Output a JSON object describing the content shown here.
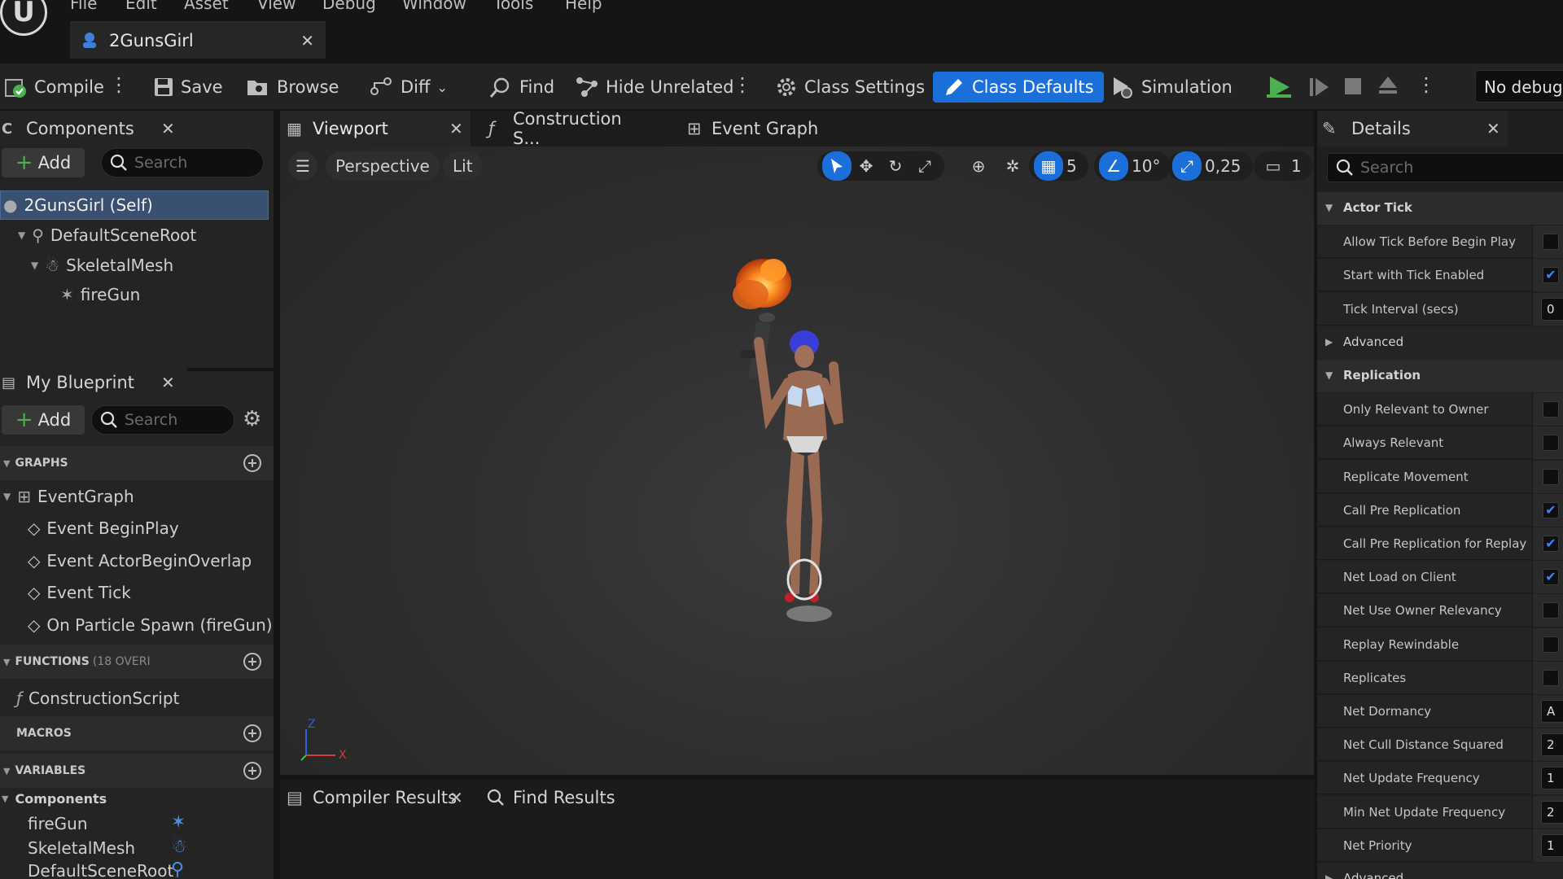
{
  "menu": [
    "File",
    "Edit",
    "Asset",
    "View",
    "Debug",
    "Window",
    "Tools",
    "Help"
  ],
  "document_tab": {
    "title": "2GunsGirl"
  },
  "toolbar": {
    "compile": "Compile",
    "save": "Save",
    "browse": "Browse",
    "diff": "Diff",
    "find": "Find",
    "hide_unrelated": "Hide Unrelated",
    "class_settings": "Class Settings",
    "class_defaults": "Class Defaults",
    "simulation": "Simulation",
    "debug_filter": "No debug o"
  },
  "components_panel": {
    "title": "Components",
    "add": "Add",
    "search_placeholder": "Search",
    "tree": [
      {
        "label": "2GunsGirl (Self)"
      },
      {
        "label": "DefaultSceneRoot"
      },
      {
        "label": "SkeletalMesh"
      },
      {
        "label": "fireGun"
      }
    ]
  },
  "blueprint_panel": {
    "title": "My Blueprint",
    "add": "Add",
    "search_placeholder": "Search",
    "graphs_header": "GRAPHS",
    "graphs": [
      "EventGraph",
      "Event BeginPlay",
      "Event ActorBeginOverlap",
      "Event Tick",
      "On Particle Spawn (fireGun)"
    ],
    "functions_header": "FUNCTIONS",
    "functions_count": "(18 OVERI",
    "functions": [
      "ConstructionScript"
    ],
    "macros_header": "MACROS",
    "variables_header": "VARIABLES",
    "variables_group": "Components",
    "variables": [
      "fireGun",
      "SkeletalMesh",
      "DefaultSceneRoot"
    ]
  },
  "center_tabs": {
    "viewport": "Viewport",
    "construction": "Construction S...",
    "event_graph": "Event Graph"
  },
  "viewport_toolbar": {
    "perspective": "Perspective",
    "lit": "Lit",
    "grid_snap": "5",
    "rotation_snap": "10°",
    "scale_snap": "0,25",
    "camera_speed": "1"
  },
  "axis": {
    "z": "Z",
    "x": "X"
  },
  "bottom_tabs": {
    "compiler_results": "Compiler Results",
    "find_results": "Find Results"
  },
  "details": {
    "title": "Details",
    "search_placeholder": "Search",
    "rows": [
      {
        "type": "cat",
        "label": "Actor Tick",
        "expanded": true
      },
      {
        "type": "prop",
        "label": "Allow Tick Before Begin Play",
        "checked": false
      },
      {
        "type": "prop",
        "label": "Start with Tick Enabled",
        "checked": true
      },
      {
        "type": "prop",
        "label": "Tick Interval (secs)",
        "value": "0"
      },
      {
        "type": "sub",
        "label": "Advanced"
      },
      {
        "type": "cat",
        "label": "Replication",
        "expanded": true
      },
      {
        "type": "prop",
        "label": "Only Relevant to Owner",
        "checked": false
      },
      {
        "type": "prop",
        "label": "Always Relevant",
        "checked": false
      },
      {
        "type": "prop",
        "label": "Replicate Movement",
        "checked": false
      },
      {
        "type": "prop",
        "label": "Call Pre Replication",
        "checked": true
      },
      {
        "type": "prop",
        "label": "Call Pre Replication for Replay",
        "checked": true
      },
      {
        "type": "prop",
        "label": "Net Load on Client",
        "checked": true
      },
      {
        "type": "prop",
        "label": "Net Use Owner Relevancy",
        "checked": false
      },
      {
        "type": "prop",
        "label": "Replay Rewindable",
        "checked": false
      },
      {
        "type": "prop",
        "label": "Replicates",
        "checked": false
      },
      {
        "type": "prop",
        "label": "Net Dormancy",
        "value": "A"
      },
      {
        "type": "prop",
        "label": "Net Cull Distance Squared",
        "value": "2"
      },
      {
        "type": "prop",
        "label": "Net Update Frequency",
        "value": "1"
      },
      {
        "type": "prop",
        "label": "Min Net Update Frequency",
        "value": "2"
      },
      {
        "type": "prop",
        "label": "Net Priority",
        "value": "1"
      },
      {
        "type": "sub",
        "label": "Advanced"
      }
    ]
  },
  "colors": {
    "accent": "#1a6fd8",
    "play_green": "#4caf50",
    "panel": "#242424"
  }
}
